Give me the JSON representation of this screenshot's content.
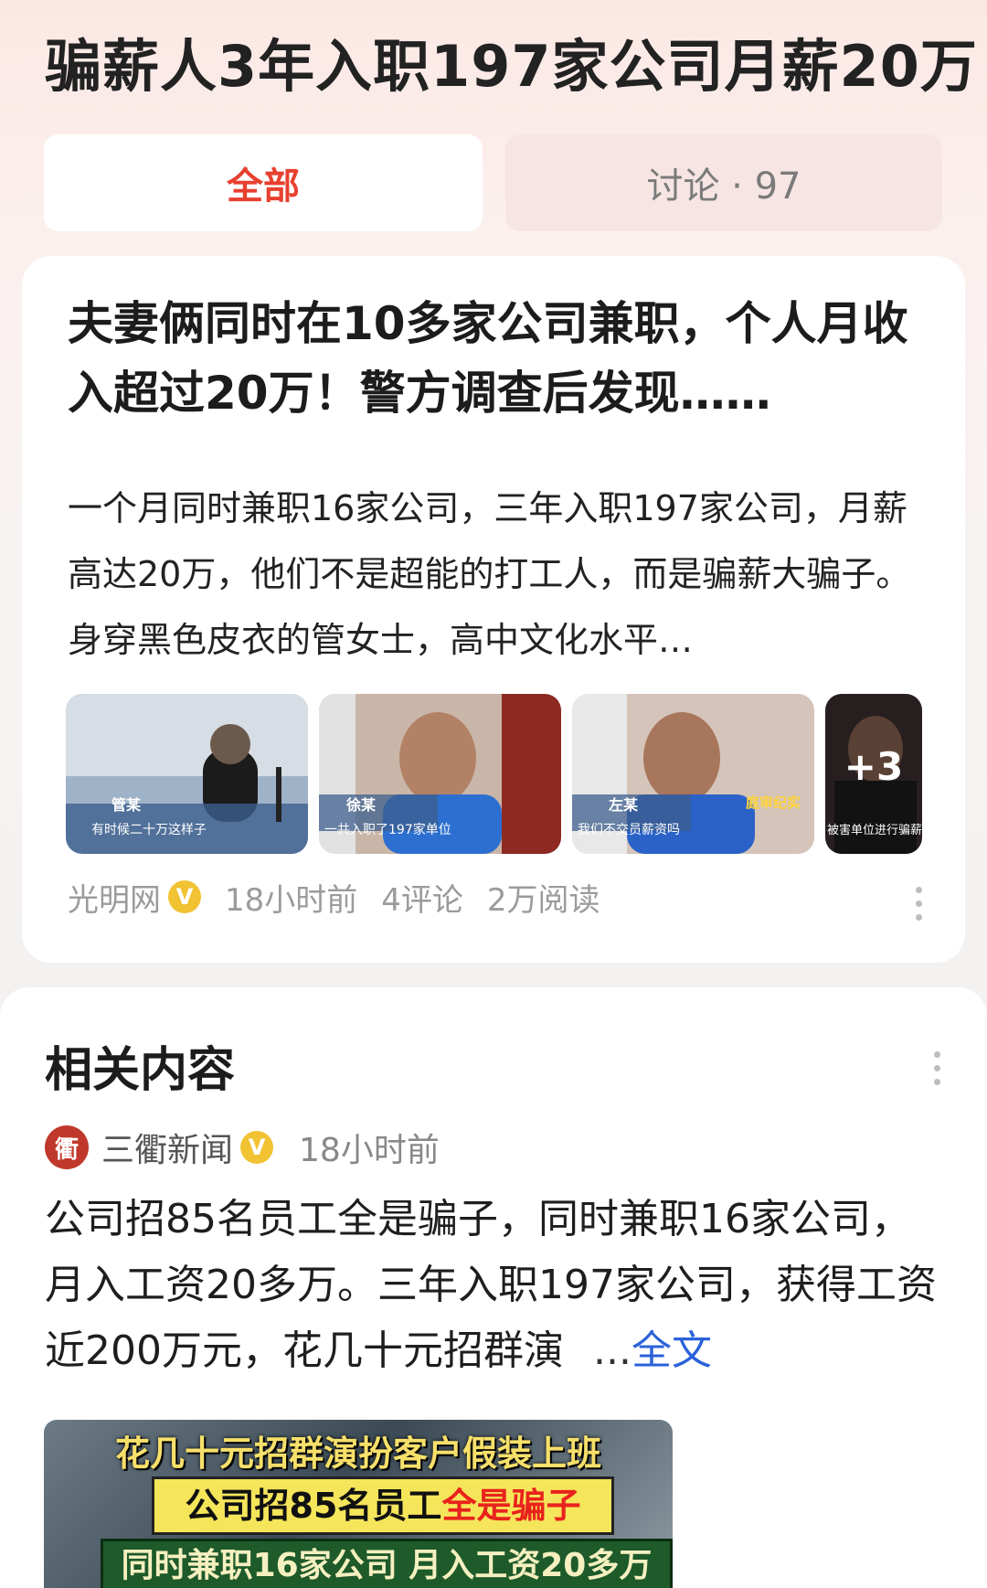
{
  "page": {
    "title": "骗薪人3年入职197家公司月薪20万"
  },
  "tabs": [
    {
      "label": "全部",
      "active": true
    },
    {
      "label": "讨论 · 97",
      "active": false
    }
  ],
  "colors": {
    "accent": "#e8402f",
    "link": "#2a62d8",
    "verified": "#f1c232"
  },
  "article": {
    "headline": "夫妻俩同时在10多家公司兼职，个人月收入超过20万！警方调查后发现……",
    "summary": "一个月同时兼职16家公司，三年入职197家公司，月薪高达20万，他们不是超能的打工人，而是骗薪大骗子。身穿黑色皮衣的管女士，高中文化水平…",
    "images": [
      {
        "caption": "有时候二十万这样子",
        "name": "管某"
      },
      {
        "caption": "一共入职了197家单位",
        "name": "徐某"
      },
      {
        "caption": "我们不交员薪资吗",
        "name": "左某",
        "tag": "庭审纪实"
      },
      {
        "caption": "被害单位进行骗薪",
        "name": ""
      }
    ],
    "more_count": "+3",
    "source": "光明网",
    "time": "18小时前",
    "comments": "4评论",
    "reads": "2万阅读"
  },
  "related": {
    "title": "相关内容",
    "source": "三衢新闻",
    "source_logo": "衢",
    "time": "18小时前",
    "text": "公司招85名员工全是骗子，同时兼职16家公司，月入工资20多万。三年入职197家公司，获得工资近200万元，花几十元招群演",
    "ellipsis": "...",
    "more_link": "全文",
    "video_captions": {
      "line1": "花几十元招群演扮客户假装上班",
      "line2_a": "公司招85名员工",
      "line2_b": "全是骗子",
      "line3": "同时兼职16家公司 月入工资20多万"
    }
  },
  "icons": {
    "verified": "verified-badge-icon",
    "more": "more-vertical-icon"
  }
}
